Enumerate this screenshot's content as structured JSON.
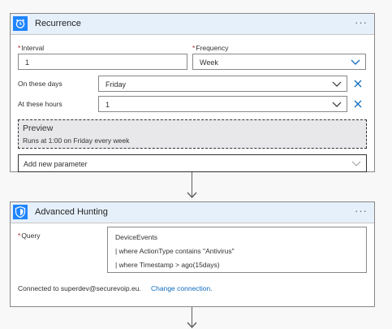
{
  "recurrence": {
    "title": "Recurrence",
    "more": "···",
    "interval": {
      "label": "Interval",
      "required_mark": "*",
      "value": "1"
    },
    "frequency": {
      "label": "Frequency",
      "required_mark": "*",
      "value": "Week"
    },
    "days": {
      "label": "On these days",
      "value": "Friday"
    },
    "hours": {
      "label": "At these hours",
      "value": "1"
    },
    "preview": {
      "title": "Preview",
      "text": "Runs at 1:00 on Friday every week"
    },
    "add_parameter": "Add new parameter"
  },
  "hunting": {
    "title": "Advanced Hunting",
    "more": "···",
    "query": {
      "label": "Query",
      "required_mark": "*",
      "lines": [
        "DeviceEvents",
        "| where ActionType contains \"Antivirus\"",
        "| where Timestamp > ago(15days)"
      ]
    },
    "connection_text": "Connected to superdev@securevoip.eu.",
    "change_connection": "Change connection."
  },
  "colors": {
    "header_bg": "#e6f0fb",
    "icon_bg": "#1f85ff",
    "link": "#0f6cbd",
    "remove_x": "#0f6cbd"
  },
  "icons": {
    "recurrence": "alarm-clock-icon",
    "hunting": "shield-icon"
  }
}
